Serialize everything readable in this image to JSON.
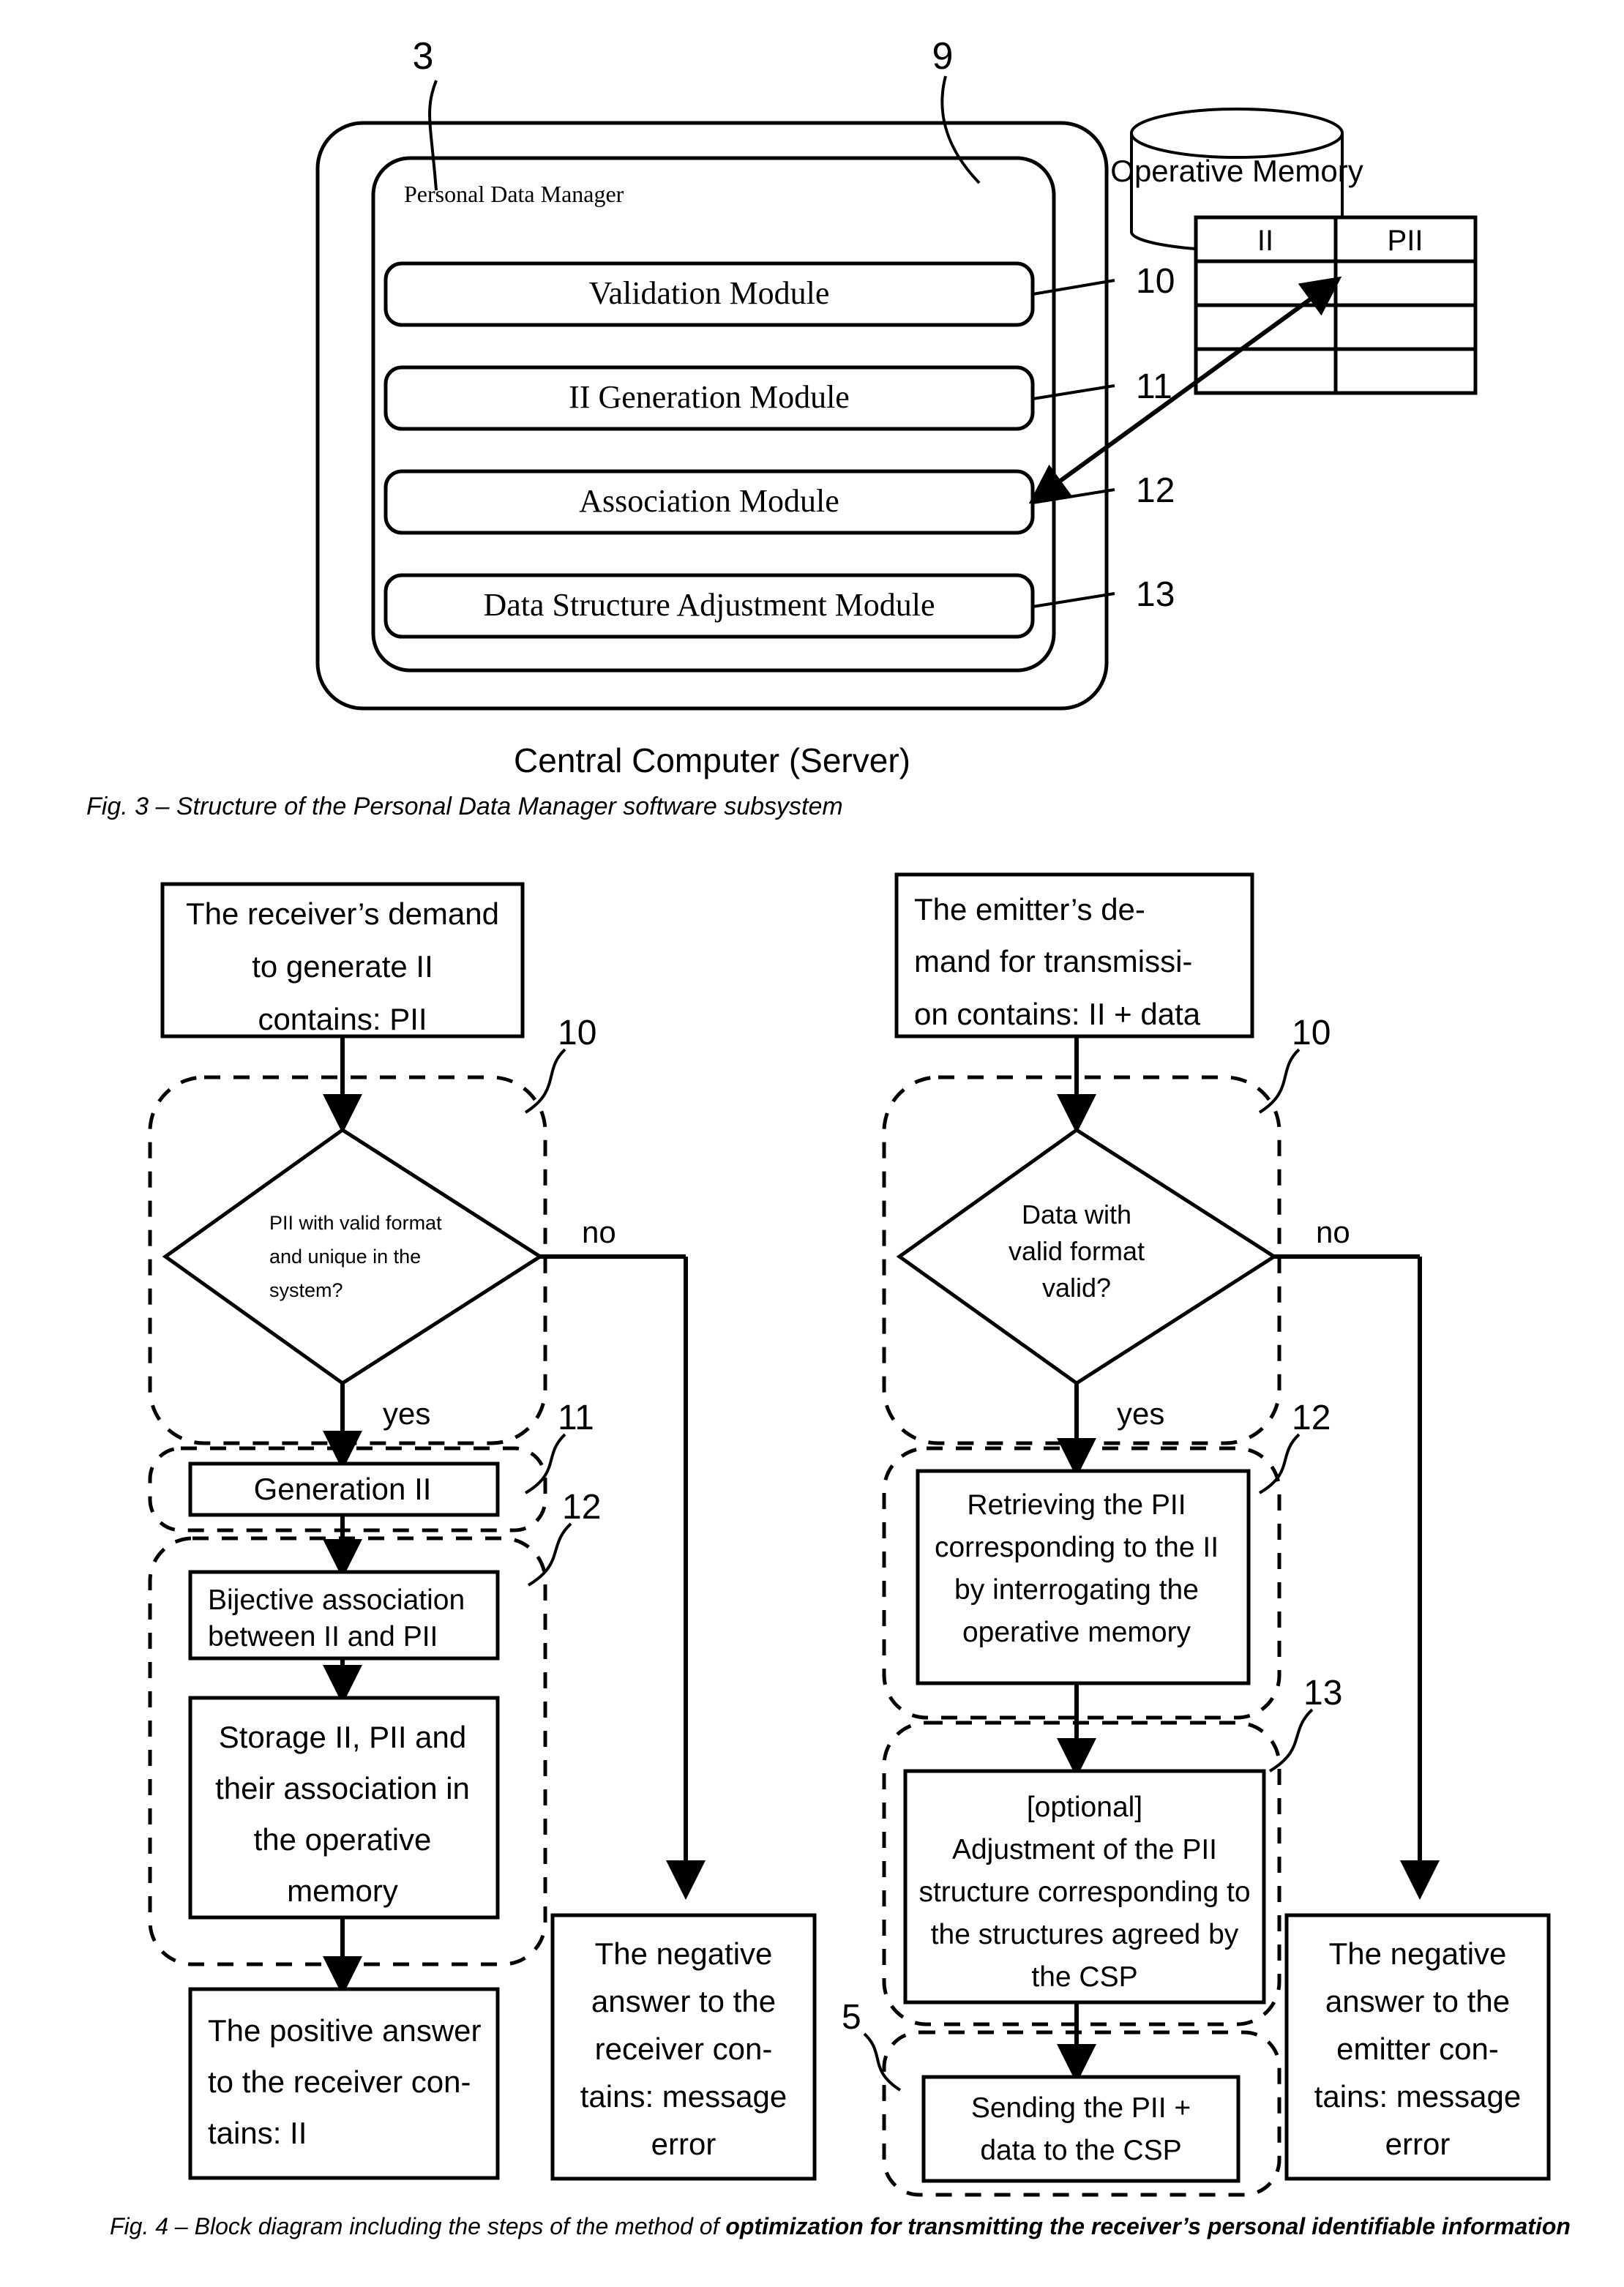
{
  "figure3": {
    "ref_labels": {
      "outer": "3",
      "inner": "9"
    },
    "inner_title": "Personal Data Manager",
    "modules": [
      {
        "label": "Validation Module",
        "ref": "10"
      },
      {
        "label": "II Generation Module",
        "ref": "11"
      },
      {
        "label": "Association Module",
        "ref": "12"
      },
      {
        "label": "Data Structure Adjustment Module",
        "ref": "13"
      }
    ],
    "memory": {
      "title": "Operative Memory",
      "columns": [
        "II",
        "PII"
      ],
      "empty_rows": 3
    },
    "bottom_label": "Central Computer (Server)",
    "caption": "Fig. 3 – Structure of the Personal Data Manager software subsystem"
  },
  "figure4": {
    "caption_plain": "Fig. 4 – Block  diagram including the steps of the method of ",
    "caption_bold": "optimization for transmitting  the receiver’s personal identifiable information",
    "left_flow": {
      "start": [
        "The receiver’s demand",
        "to generate II",
        "contains: PII"
      ],
      "decision": [
        "PII with valid format",
        "and unique in the",
        "system?"
      ],
      "decision_ref": "10",
      "branch_yes": "yes",
      "branch_no": "no",
      "generation": [
        "Generation II"
      ],
      "generation_ref": "11",
      "association": [
        "Bijective association",
        "between  II and PII"
      ],
      "association_ref": "12",
      "storage": [
        "Storage II, PII and",
        "their association in",
        "the operative",
        "memory"
      ],
      "positive": [
        "The positive answer",
        "to the receiver con-",
        "tains: II"
      ],
      "negative": [
        "The negative",
        "answer to the",
        "receiver con-",
        "tains: message",
        "error"
      ]
    },
    "right_flow": {
      "start": [
        "The emitter’s de-",
        "mand for transmissi-",
        "on contains: II + data"
      ],
      "decision": [
        "Data with",
        "valid format",
        "valid?"
      ],
      "decision_ref": "10",
      "branch_yes": "yes",
      "branch_no": "no",
      "retrieving": [
        "Retrieving the PII",
        "corresponding to the  II",
        "by interrogating the",
        "operative memory"
      ],
      "retrieving_ref": "12",
      "adjustment": [
        "[optional]",
        "Adjustment of the PII",
        "structure corresponding to",
        "the structures agreed by",
        "the CSP"
      ],
      "adjustment_ref": "13",
      "sending": [
        "Sending the PII +",
        "data to the CSP"
      ],
      "sending_ref": "5",
      "negative": [
        "The negative",
        "answer to the",
        "emitter con-",
        "tains: message",
        "error"
      ]
    }
  },
  "colors": {
    "ink": "#000000",
    "paper": "#ffffff"
  }
}
